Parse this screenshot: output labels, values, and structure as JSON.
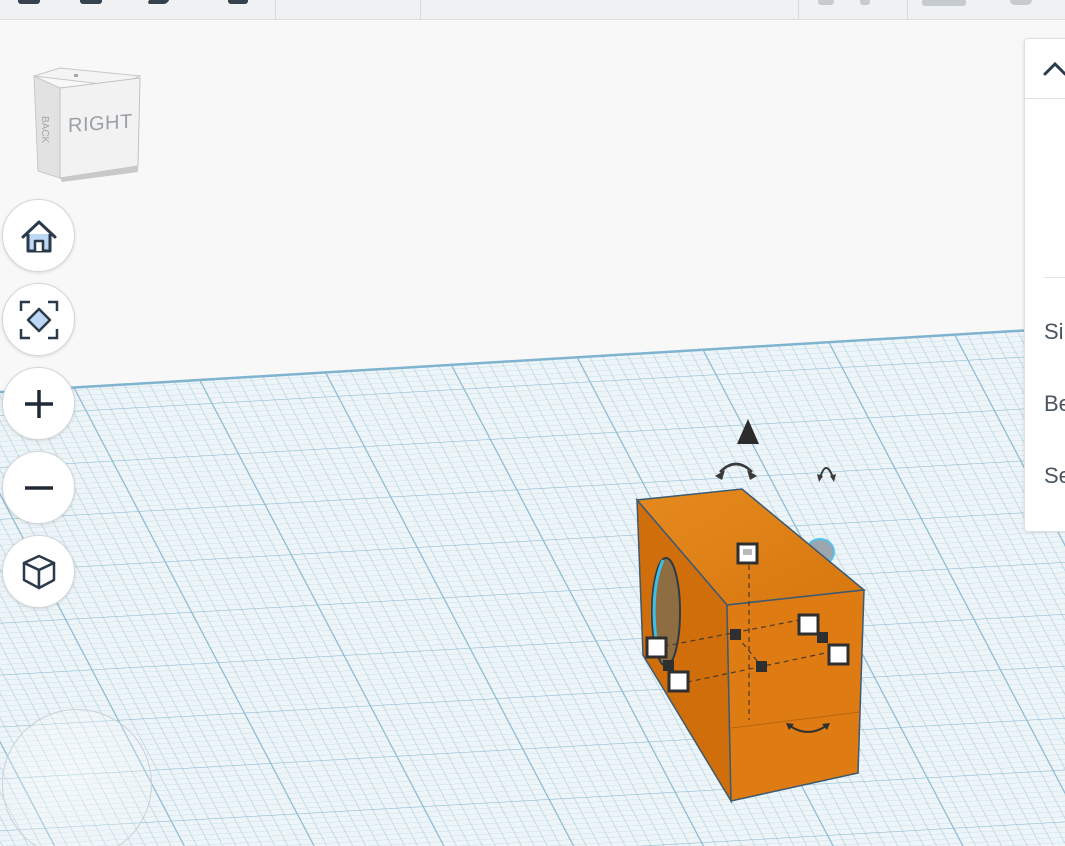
{
  "toolbar": {
    "icons": [
      "copy-icon",
      "paste-icon",
      "duplicate-icon",
      "delete-icon",
      "lock-icon",
      "light-icon",
      "align-icon",
      "help-icon"
    ]
  },
  "view_cube": {
    "face_label": "RIGHT",
    "side_label": "BACK"
  },
  "nav_buttons": [
    "home-view",
    "fit-all-in-view",
    "zoom-in",
    "zoom-out",
    "toggle-projection"
  ],
  "inspector": {
    "rows": [
      "Si",
      "Be",
      "Se"
    ]
  },
  "colors": {
    "accent_orange": "#e07b12",
    "grid_line": "#9dc3d8",
    "workplane_bg": "#eef5f8"
  }
}
